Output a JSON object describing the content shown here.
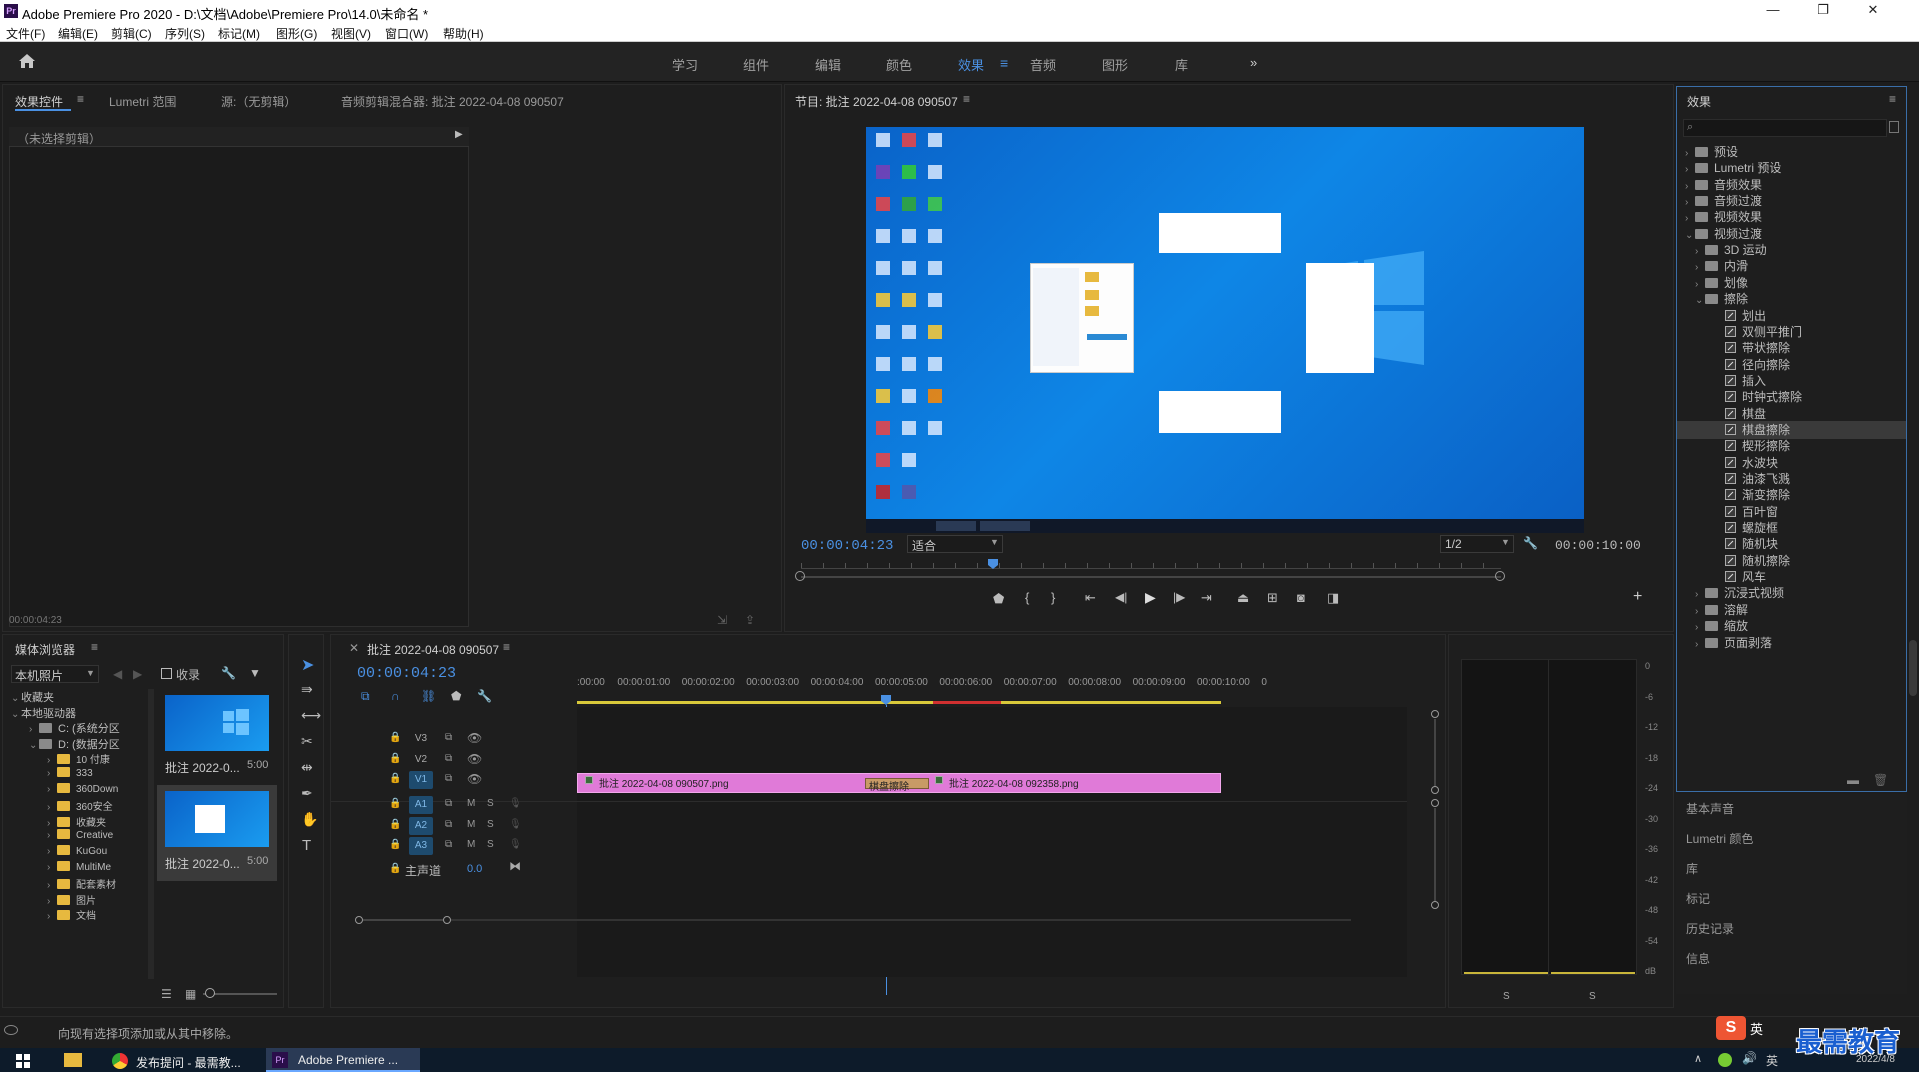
{
  "titlebar": {
    "app_icon": "Pr",
    "title": "Adobe Premiere Pro 2020 - D:\\文档\\Adobe\\Premiere Pro\\14.0\\未命名 *",
    "minimize": "—",
    "maximize": "❐",
    "close": "✕"
  },
  "menubar": [
    "文件(F)",
    "编辑(E)",
    "剪辑(C)",
    "序列(S)",
    "标记(M)",
    "图形(G)",
    "视图(V)",
    "窗口(W)",
    "帮助(H)"
  ],
  "workspace": {
    "tabs": [
      "学习",
      "组件",
      "编辑",
      "颜色",
      "效果",
      "音频",
      "图形",
      "库"
    ],
    "active": "效果",
    "more": "»"
  },
  "source_panel": {
    "tabs": [
      "效果控件",
      "Lumetri 范围",
      "源:（无剪辑）",
      "音频剪辑混合器: 批注 2022-04-08 090507"
    ],
    "no_clip": "（未选择剪辑）",
    "timecode": "00:00:04:23"
  },
  "program_monitor": {
    "title": "节目: 批注 2022-04-08 090507",
    "timecode": "00:00:04:23",
    "fit": "适合",
    "resolution": "1/2",
    "duration": "00:00:10:00",
    "progress_fraction": 0.48
  },
  "effects_panel": {
    "title": "效果",
    "items": [
      {
        "label": "预设",
        "depth": 0,
        "open": false
      },
      {
        "label": "Lumetri 预设",
        "depth": 0,
        "open": false
      },
      {
        "label": "音频效果",
        "depth": 0,
        "open": false
      },
      {
        "label": "音频过渡",
        "depth": 0,
        "open": false
      },
      {
        "label": "视频效果",
        "depth": 0,
        "open": false
      },
      {
        "label": "视频过渡",
        "depth": 0,
        "open": true
      },
      {
        "label": "3D 运动",
        "depth": 1,
        "open": false
      },
      {
        "label": "内滑",
        "depth": 1,
        "open": false
      },
      {
        "label": "划像",
        "depth": 1,
        "open": false
      },
      {
        "label": "擦除",
        "depth": 1,
        "open": true
      },
      {
        "label": "划出",
        "depth": 2,
        "fx": true
      },
      {
        "label": "双侧平推门",
        "depth": 2,
        "fx": true
      },
      {
        "label": "带状擦除",
        "depth": 2,
        "fx": true
      },
      {
        "label": "径向擦除",
        "depth": 2,
        "fx": true
      },
      {
        "label": "插入",
        "depth": 2,
        "fx": true
      },
      {
        "label": "时钟式擦除",
        "depth": 2,
        "fx": true
      },
      {
        "label": "棋盘",
        "depth": 2,
        "fx": true
      },
      {
        "label": "棋盘擦除",
        "depth": 2,
        "fx": true,
        "selected": true
      },
      {
        "label": "楔形擦除",
        "depth": 2,
        "fx": true
      },
      {
        "label": "水波块",
        "depth": 2,
        "fx": true
      },
      {
        "label": "油漆飞溅",
        "depth": 2,
        "fx": true
      },
      {
        "label": "渐变擦除",
        "depth": 2,
        "fx": true
      },
      {
        "label": "百叶窗",
        "depth": 2,
        "fx": true
      },
      {
        "label": "螺旋框",
        "depth": 2,
        "fx": true
      },
      {
        "label": "随机块",
        "depth": 2,
        "fx": true
      },
      {
        "label": "随机擦除",
        "depth": 2,
        "fx": true
      },
      {
        "label": "风车",
        "depth": 2,
        "fx": true
      },
      {
        "label": "沉浸式视频",
        "depth": 1,
        "open": false
      },
      {
        "label": "溶解",
        "depth": 1,
        "open": false
      },
      {
        "label": "缩放",
        "depth": 1,
        "open": false
      },
      {
        "label": "页面剥落",
        "depth": 1,
        "open": false
      }
    ],
    "side_panels": [
      "基本声音",
      "Lumetri 颜色",
      "库",
      "标记",
      "历史记录",
      "信息"
    ]
  },
  "media_browser": {
    "title": "媒体浏览器",
    "location": "本机照片",
    "favorites_checkbox": "收录",
    "tree": [
      {
        "label": "收藏夹",
        "depth": 0
      },
      {
        "label": "本地驱动器",
        "depth": 0
      },
      {
        "label": "C: (系统分区",
        "depth": 1
      },
      {
        "label": "D: (数据分区",
        "depth": 1
      },
      {
        "label": "10 付康",
        "depth": 2
      },
      {
        "label": "333",
        "depth": 2
      },
      {
        "label": "360Down",
        "depth": 2
      },
      {
        "label": "360安全",
        "depth": 2
      },
      {
        "label": "收藏夹",
        "depth": 2
      },
      {
        "label": "Creative",
        "depth": 2
      },
      {
        "label": "KuGou",
        "depth": 2
      },
      {
        "label": "MultiMe",
        "depth": 2
      },
      {
        "label": "配套素材",
        "depth": 2
      },
      {
        "label": "图片",
        "depth": 2
      },
      {
        "label": "文档",
        "depth": 2
      }
    ],
    "thumbs": [
      {
        "name": "批注 2022-0...",
        "duration": "5:00"
      },
      {
        "name": "批注 2022-0...",
        "duration": "5:00"
      }
    ]
  },
  "timeline": {
    "title": "批注 2022-04-08 090507",
    "timecode": "00:00:04:23",
    "ruler": [
      ":00:00",
      "00:00:01:00",
      "00:00:02:00",
      "00:00:03:00",
      "00:00:04:00",
      "00:00:05:00",
      "00:00:06:00",
      "00:00:07:00",
      "00:00:08:00",
      "00:00:09:00",
      "00:00:10:00",
      "0"
    ],
    "video_tracks": [
      "V3",
      "V2",
      "V1"
    ],
    "audio_tracks": [
      "A1",
      "A2",
      "A3"
    ],
    "master": "主声道",
    "master_value": "0.0",
    "clip1": "批注 2022-04-08 090507.png",
    "clip2": "批注 2022-04-08 092358.png",
    "transition": "棋盘擦除",
    "clip_color": "#e07ad8"
  },
  "audio_meter": {
    "scale": [
      "0",
      "-6",
      "-12",
      "-18",
      "-24",
      "-30",
      "-36",
      "-42",
      "-48",
      "-54",
      "dB"
    ],
    "solo": [
      "S",
      "S"
    ]
  },
  "status": {
    "message": "向现有选择项添加或从其中移除。"
  },
  "taskbar": {
    "items": [
      "发布提问 - 最需教...",
      "Adobe Premiere ..."
    ],
    "date": "2022/4/8",
    "ime": "英",
    "watermark": "最需教育"
  }
}
